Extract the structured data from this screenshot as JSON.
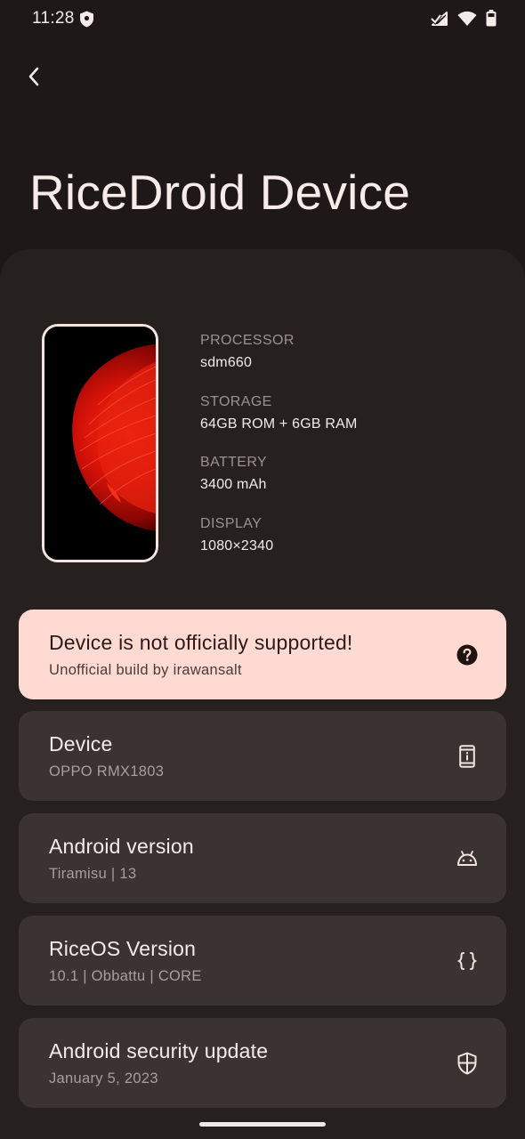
{
  "status_bar": {
    "time": "11:28"
  },
  "header": {
    "title": "RiceDroid Device"
  },
  "specs": [
    {
      "label": "PROCESSOR",
      "value": "sdm660"
    },
    {
      "label": "STORAGE",
      "value": "64GB ROM + 6GB RAM"
    },
    {
      "label": "BATTERY",
      "value": "3400 mAh"
    },
    {
      "label": "DISPLAY",
      "value": "1080×2340"
    }
  ],
  "support_card": {
    "title": "Device is not officially supported!",
    "subtitle": "Unofficial build by irawansalt",
    "icon": "help-circle-icon"
  },
  "info_cards": [
    {
      "title": "Device",
      "subtitle": "OPPO RMX1803",
      "icon": "phone-info-icon"
    },
    {
      "title": "Android version",
      "subtitle": "Tiramisu | 13",
      "icon": "android-icon"
    },
    {
      "title": "RiceOS Version",
      "subtitle": "10.1 | Obbattu | CORE",
      "icon": "braces-icon"
    },
    {
      "title": "Android security update",
      "subtitle": "January 5, 2023",
      "icon": "shield-icon"
    }
  ],
  "colors": {
    "background": "#1e1918",
    "panel": "#26201f",
    "card": "#3a3332",
    "warning_card": "#ffdad3"
  }
}
